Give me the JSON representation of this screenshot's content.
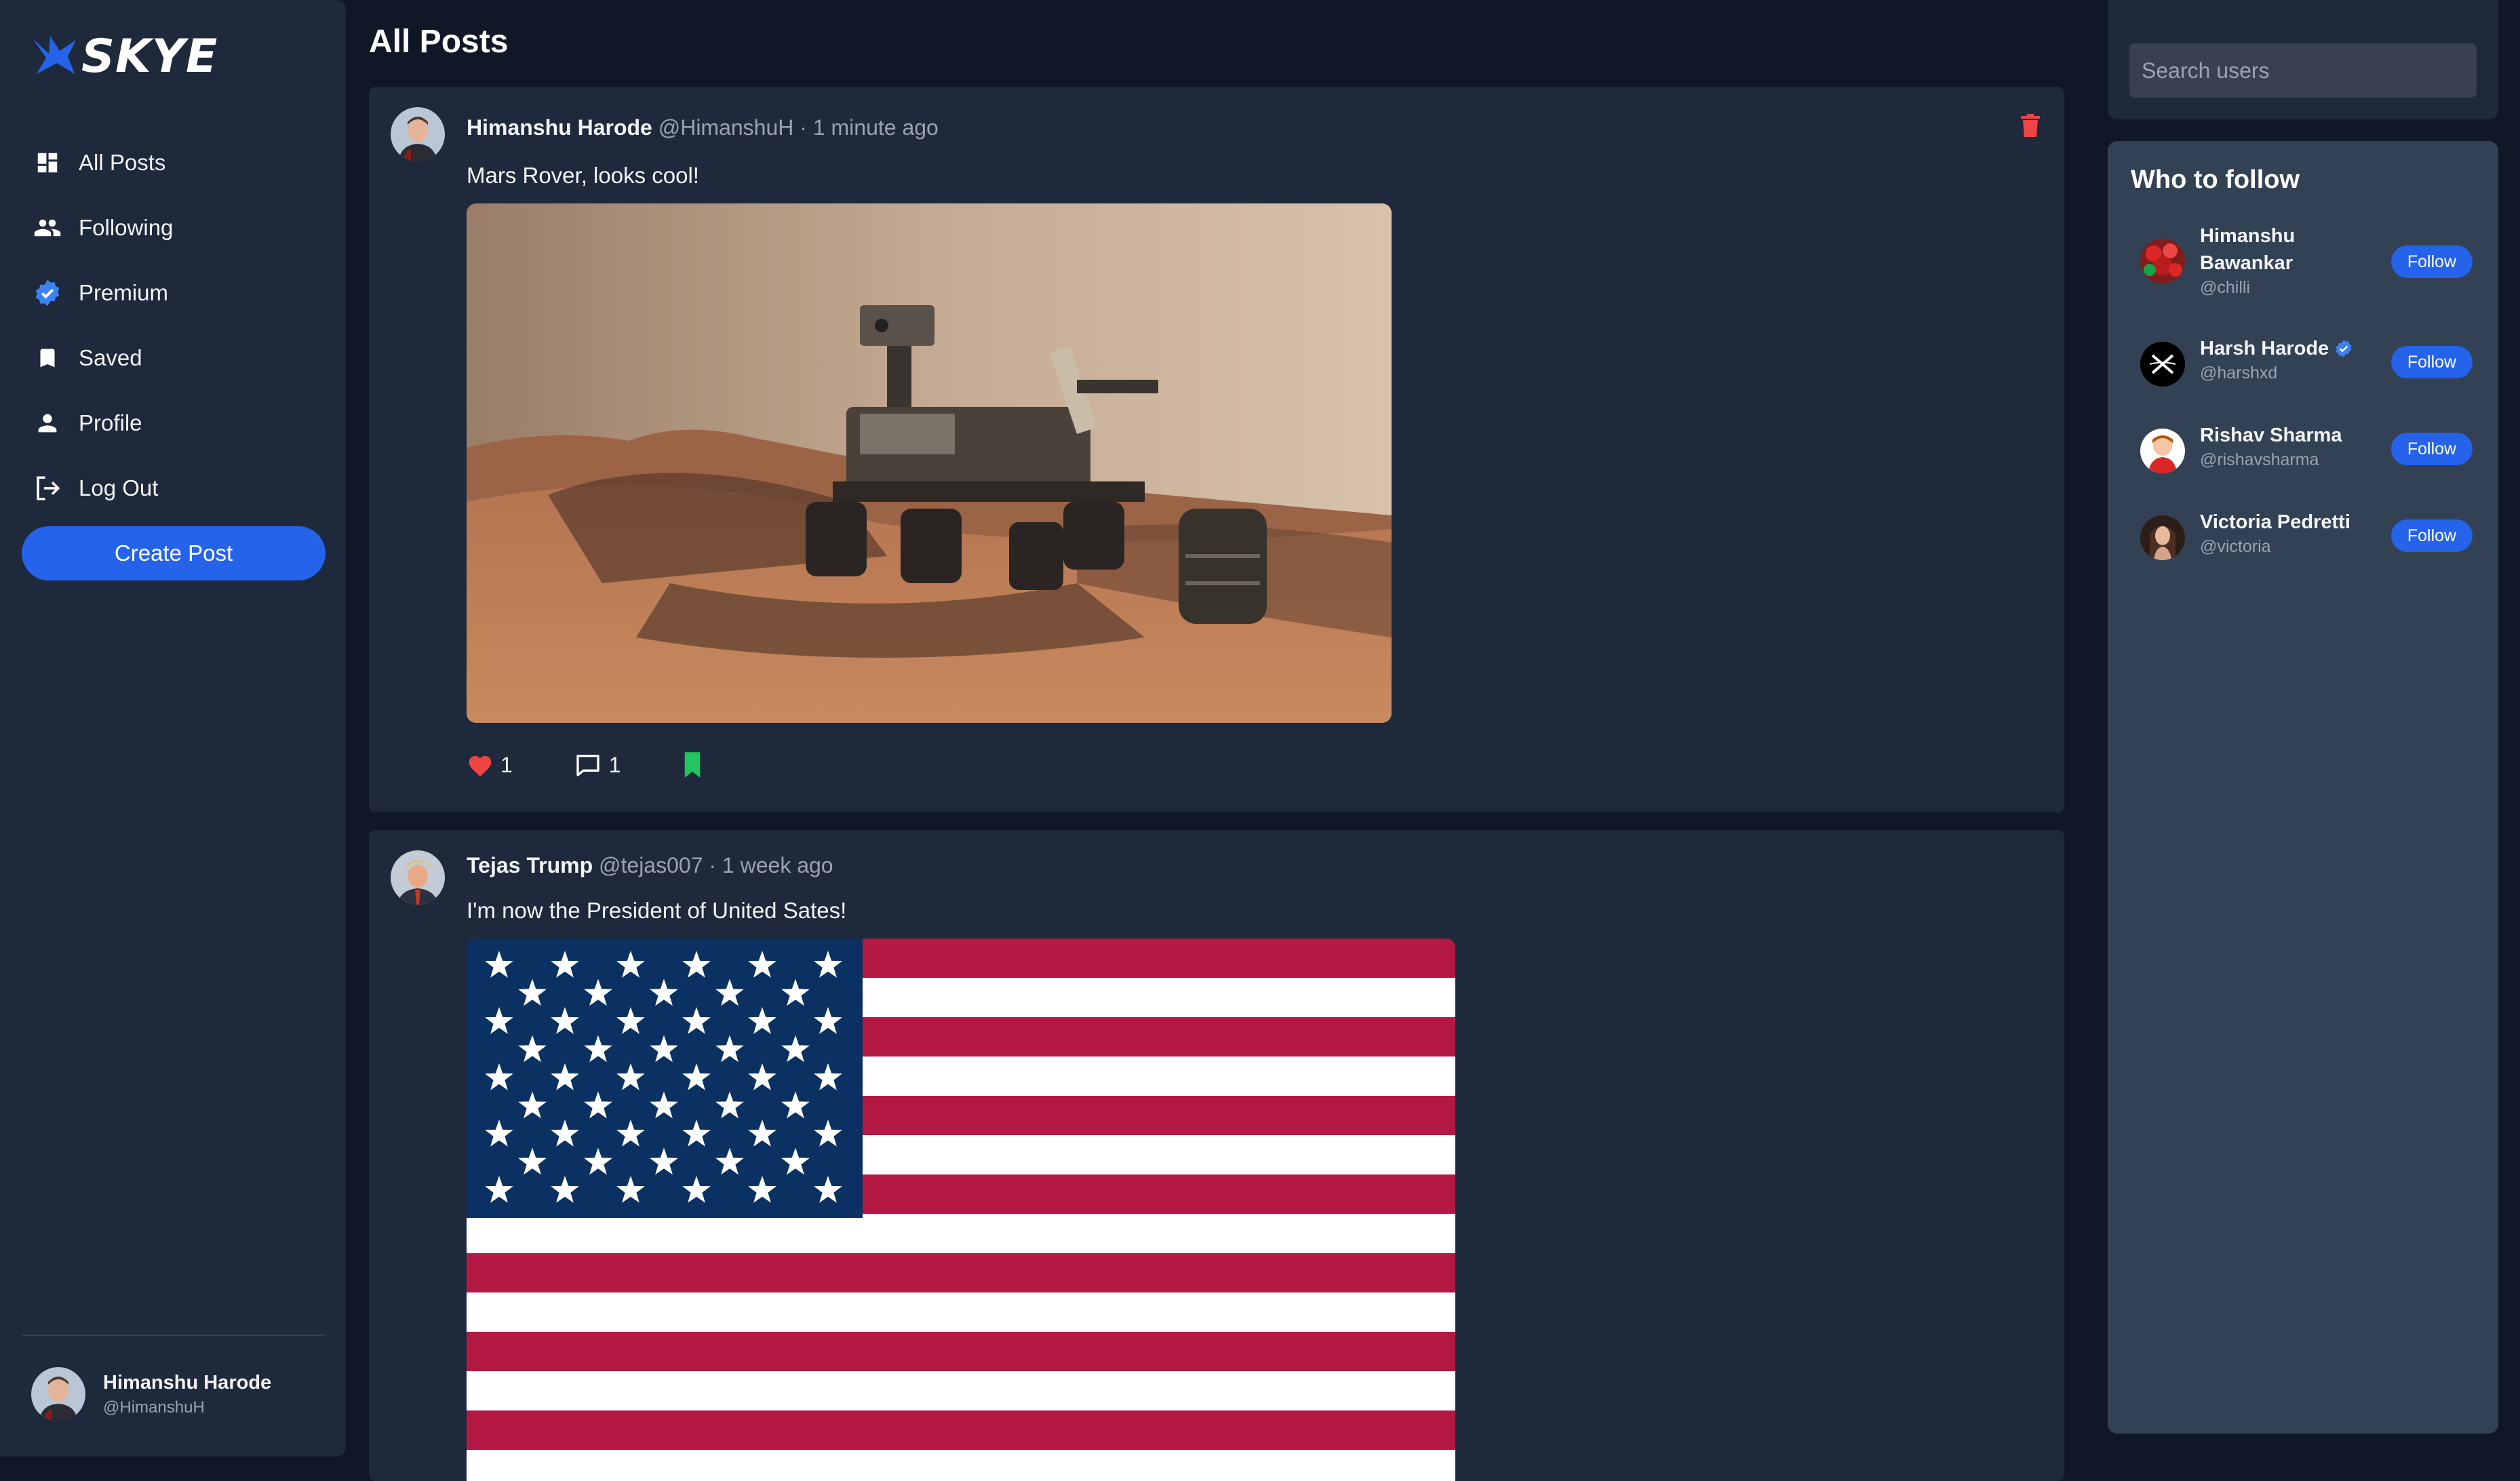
{
  "app": {
    "name": "SKYE"
  },
  "sidebar": {
    "items": [
      {
        "label": "All Posts",
        "icon": "dashboard-icon"
      },
      {
        "label": "Following",
        "icon": "people-icon"
      },
      {
        "label": "Premium",
        "icon": "verified-badge-icon"
      },
      {
        "label": "Saved",
        "icon": "bookmark-icon"
      },
      {
        "label": "Profile",
        "icon": "person-icon"
      },
      {
        "label": "Log Out",
        "icon": "logout-icon"
      }
    ],
    "create_label": "Create Post",
    "user": {
      "name": "Himanshu Harode",
      "handle": "@HimanshuH"
    }
  },
  "main": {
    "title": "All Posts",
    "posts": [
      {
        "author": "Himanshu Harode",
        "meta": "@HimanshuH · 1 minute ago",
        "text": "Mars Rover, looks cool!",
        "likes": "1",
        "comments": "1",
        "liked": true,
        "saved": true
      },
      {
        "author": "Tejas Trump",
        "meta": "@tejas007 · 1 week ago",
        "text": "I'm now the President of United Sates!"
      }
    ]
  },
  "right": {
    "search_placeholder": "Search users",
    "who_title": "Who to follow",
    "follow_label": "Follow",
    "users": [
      {
        "name_line1": "Himanshu",
        "name_line2": "Bawankar",
        "handle": "@chilli"
      },
      {
        "name": "Harsh Harode",
        "handle": "@harshxd",
        "verified": true
      },
      {
        "name": "Rishav Sharma",
        "handle": "@rishavsharma"
      },
      {
        "name": "Victoria Pedretti",
        "handle": "@victoria"
      }
    ]
  },
  "colors": {
    "background": "#101828",
    "panel": "#1e293b",
    "accent": "#2563eb",
    "like": "#ef4444",
    "saved": "#22c55e",
    "delete": "#ef4444"
  }
}
